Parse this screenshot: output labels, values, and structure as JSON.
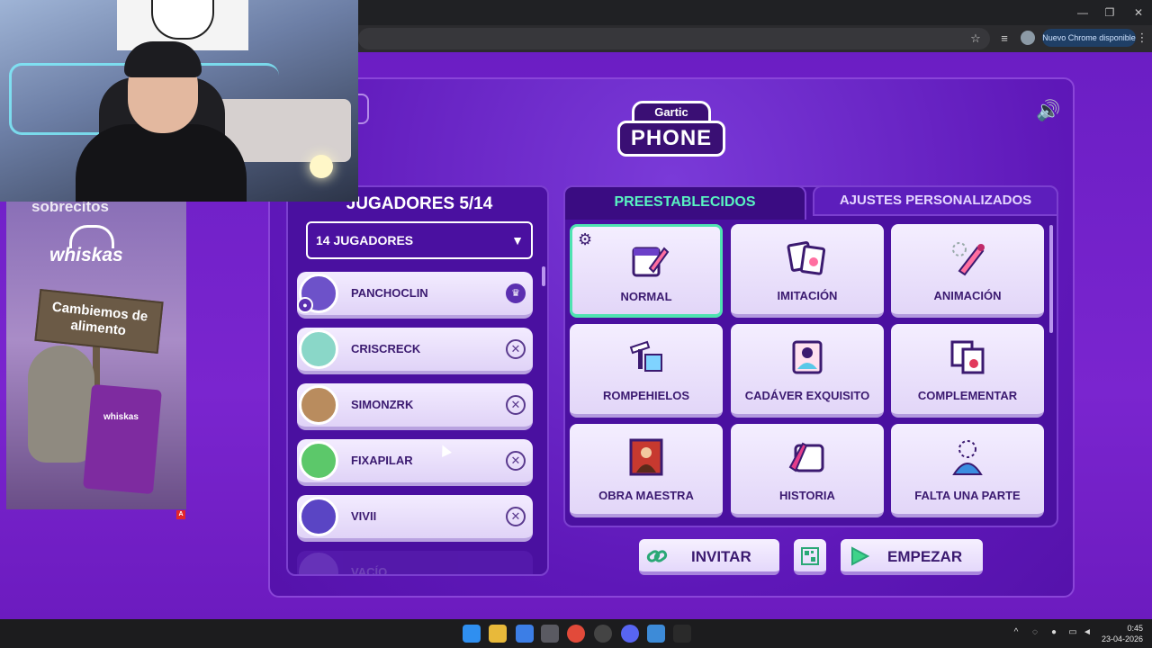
{
  "browser": {
    "update_chip": "Nuevo Chrome disponible",
    "star_icon": "star-icon",
    "menu_icon": "more-vert-icon"
  },
  "game": {
    "logo_top": "Gartic",
    "logo_main": "PHONE",
    "players_title": "JUGADORES 5/14",
    "player_count_select": "14 JUGADORES",
    "players": [
      {
        "name": "PANCHOCLIN",
        "action": "crown",
        "avatar_color": "#6d52c9"
      },
      {
        "name": "CRISCRECK",
        "action": "remove",
        "avatar_color": "#8ad7c8"
      },
      {
        "name": "SIMONZRK",
        "action": "remove",
        "avatar_color": "#b98c5e"
      },
      {
        "name": "FIXAPILAR",
        "action": "remove",
        "avatar_color": "#5cc86a"
      },
      {
        "name": "VIVII",
        "action": "remove",
        "avatar_color": "#5a45c4"
      },
      {
        "name": "VACÍO",
        "action": "",
        "avatar_color": "#7a4ac9"
      }
    ],
    "tabs": {
      "preset": "PREESTABLECIDOS",
      "custom": "AJUSTES PERSONALIZADOS"
    },
    "modes": [
      {
        "label": "NORMAL",
        "selected": true
      },
      {
        "label": "IMITACIÓN",
        "selected": false
      },
      {
        "label": "ANIMACIÓN",
        "selected": false
      },
      {
        "label": "ROMPEHIELOS",
        "selected": false
      },
      {
        "label": "CADÁVER EXQUISITO",
        "selected": false
      },
      {
        "label": "COMPLEMENTAR",
        "selected": false
      },
      {
        "label": "OBRA MAESTRA",
        "selected": false
      },
      {
        "label": "HISTORIA",
        "selected": false
      },
      {
        "label": "FALTA UNA PARTE",
        "selected": false
      }
    ],
    "buttons": {
      "invite": "INVITAR",
      "start": "EMPEZAR"
    },
    "accent_color": "#59f3c1"
  },
  "ad": {
    "top_text": "sobrecitos",
    "brand": "whiskas",
    "sign": "Cambiemos de alimento",
    "pouch_brand": "whiskas",
    "badge": "A"
  },
  "taskbar": {
    "time": "0:45",
    "date": "23-04-2026"
  }
}
